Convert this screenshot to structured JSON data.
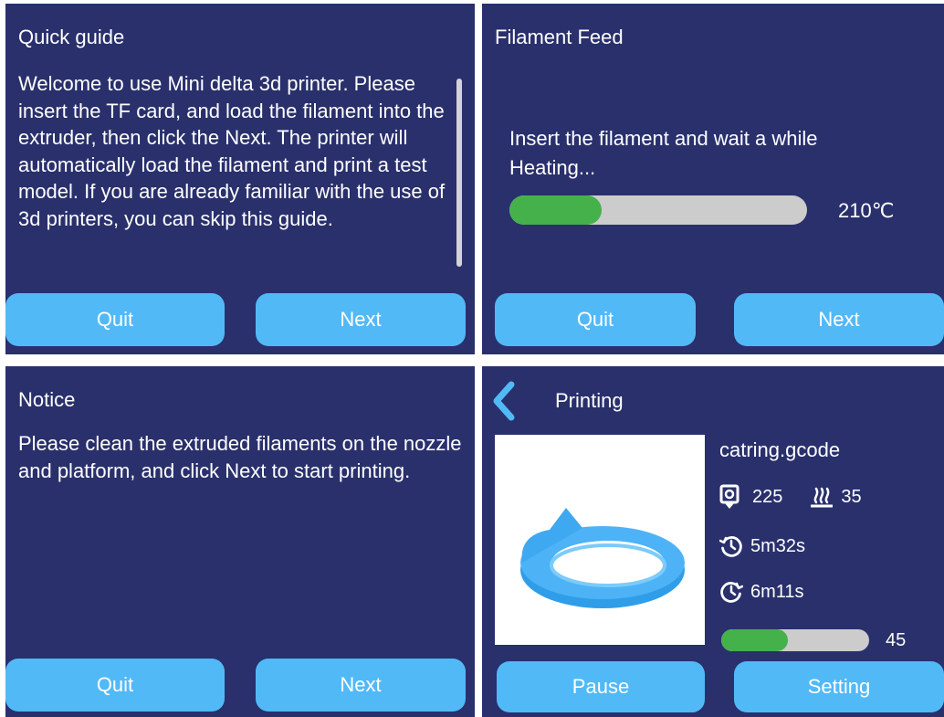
{
  "guide": {
    "title": "Quick guide",
    "text": "Welcome to use Mini delta 3d printer. Please insert the TF card, and load the filament into the extruder, then click the Next. The printer will automatically load the filament and print a test model. If you are already familiar with the use of 3d printers, you can skip this guide.",
    "quit_label": "Quit",
    "next_label": "Next"
  },
  "feed": {
    "title": "Filament Feed",
    "instruction": "Insert the filament and wait a while",
    "status": "Heating...",
    "temperature": "210℃",
    "progress": 0.31,
    "quit_label": "Quit",
    "next_label": "Next"
  },
  "notice": {
    "title": "Notice",
    "text": "Please clean the extruded filaments on the nozzle and platform, and click Next to start printing.",
    "quit_label": "Quit",
    "next_label": "Next"
  },
  "printing": {
    "title": "Printing",
    "filename": "catring.gcode",
    "nozzle_temp": "225",
    "bed_temp": "35",
    "elapsed": "5m32s",
    "remaining": "6m11s",
    "progress_value": "45",
    "progress": 0.45,
    "pause_label": "Pause",
    "setting_label": "Setting"
  },
  "colors": {
    "panel_bg": "#29306c",
    "button": "#52b9f7",
    "progress_fill": "#45b14a",
    "progress_track": "#cccccc",
    "accent_back": "#52b9f7"
  },
  "icons": [
    "back-chevron-icon",
    "nozzle-icon",
    "heated-bed-icon",
    "elapsed-time-icon",
    "remaining-time-icon"
  ]
}
